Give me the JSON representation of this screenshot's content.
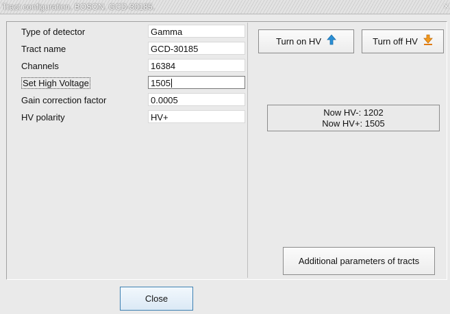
{
  "window": {
    "title": "Tract configuration. BOSON. GCD-30185.",
    "close_glyph": "×"
  },
  "fields": [
    {
      "label": "Type of detector",
      "value": "Gamma"
    },
    {
      "label": "Tract name",
      "value": "GCD-30185"
    },
    {
      "label": "Channels",
      "value": "16384"
    },
    {
      "label": "Set High Voltage",
      "value": "1505"
    },
    {
      "label": "Gain correction factor",
      "value": "0.0005"
    },
    {
      "label": "HV polarity",
      "value": "HV+"
    }
  ],
  "buttons": {
    "turn_on_hv": "Turn on HV",
    "turn_off_hv": "Turn off HV",
    "additional_params": "Additional parameters of tracts",
    "close": "Close"
  },
  "status": {
    "hv_minus": "Now HV-: 1202",
    "hv_plus": "Now HV+: 1505"
  },
  "icons": {
    "turn_on": "arrow-up-icon",
    "turn_off": "arrow-down-icon",
    "up_color": "#2a8fd6",
    "down_color": "#e07a10"
  }
}
